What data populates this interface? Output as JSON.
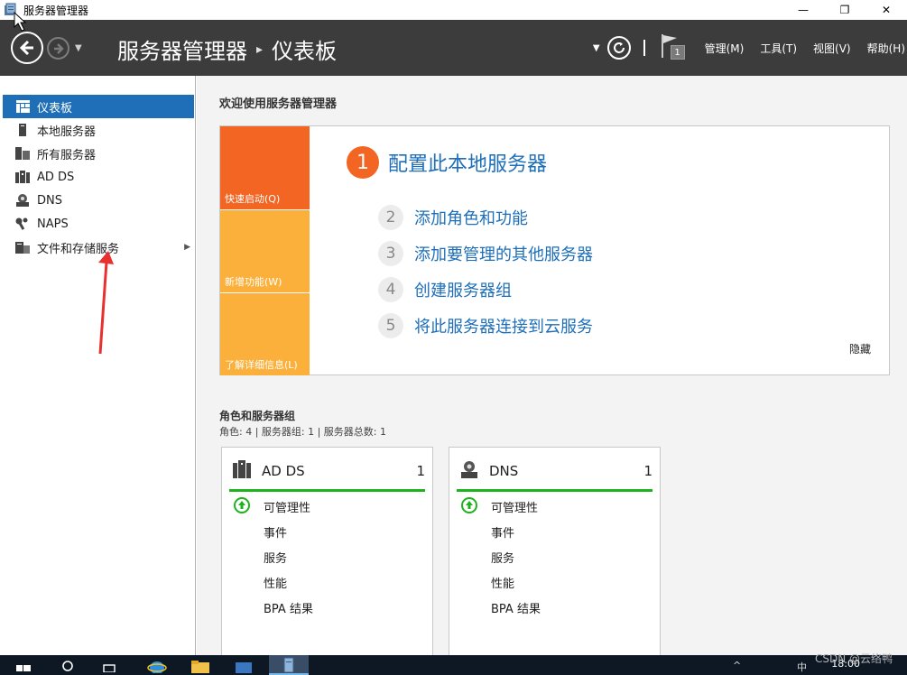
{
  "window": {
    "title": "服务器管理器",
    "minimize": "—",
    "maximize": "❐",
    "close": "✕"
  },
  "header": {
    "breadcrumb_app": "服务器管理器",
    "breadcrumb_sep": "▸",
    "breadcrumb_page": "仪表板",
    "flag_badge": "1",
    "menus": [
      "管理(M)",
      "工具(T)",
      "视图(V)",
      "帮助(H)"
    ]
  },
  "sidebar": {
    "items": [
      {
        "label": "仪表板",
        "icon": "dashboard-icon",
        "active": true
      },
      {
        "label": "本地服务器",
        "icon": "server-icon"
      },
      {
        "label": "所有服务器",
        "icon": "servers-icon"
      },
      {
        "label": "AD DS",
        "icon": "ad-ds-icon"
      },
      {
        "label": "DNS",
        "icon": "dns-icon"
      },
      {
        "label": "NAPS",
        "icon": "naps-icon"
      },
      {
        "label": "文件和存储服务",
        "icon": "storage-icon",
        "has_children": true
      }
    ]
  },
  "welcome": {
    "title": "欢迎使用服务器管理器",
    "tiles": [
      "快速启动(Q)",
      "新增功能(W)",
      "了解详细信息(L)"
    ],
    "step1": {
      "num": "1",
      "label": "配置此本地服务器"
    },
    "steps": [
      {
        "num": "2",
        "label": "添加角色和功能"
      },
      {
        "num": "3",
        "label": "添加要管理的其他服务器"
      },
      {
        "num": "4",
        "label": "创建服务器组"
      },
      {
        "num": "5",
        "label": "将此服务器连接到云服务"
      }
    ],
    "hide": "隐藏"
  },
  "roles": {
    "title": "角色和服务器组",
    "summary": "角色: 4 | 服务器组: 1 | 服务器总数: 1",
    "cards": [
      {
        "name": "AD DS",
        "count": "1",
        "icon": "ad-ds-icon",
        "rows": [
          "可管理性",
          "事件",
          "服务",
          "性能",
          "BPA 结果"
        ]
      },
      {
        "name": "DNS",
        "count": "1",
        "icon": "dns-icon",
        "rows": [
          "可管理性",
          "事件",
          "服务",
          "性能",
          "BPA 结果"
        ]
      }
    ]
  },
  "taskbar": {
    "time": "18:00",
    "ime": "中",
    "watermark": "CSDN @云络鸭"
  },
  "colors": {
    "header_bg": "#3c3c3c",
    "accent_blue": "#1e6fb8",
    "tile_orange": "#f26522",
    "tile_yellow": "#fbb03b",
    "status_green": "#1db31d"
  }
}
